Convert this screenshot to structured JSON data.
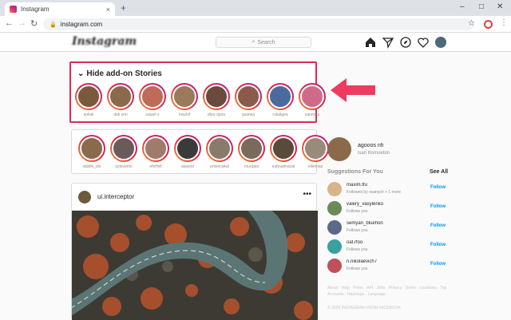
{
  "browser": {
    "tab_title": "Instagram",
    "tab_close": "×",
    "new_tab": "+",
    "window_minimize": "–",
    "window_maximize": "□",
    "window_close": "✕",
    "back": "←",
    "forward": "→",
    "reload": "↻",
    "url": "instagram.com",
    "lock": "🔒",
    "star": "☆",
    "menu": "⋮"
  },
  "header": {
    "logo": "Instagram",
    "search_placeholder": "Search",
    "icons": [
      "home-icon",
      "direct-icon",
      "explore-icon",
      "heart-icon",
      "profile-avatar"
    ]
  },
  "addon": {
    "toggle_icon": "chevron-down-icon",
    "label": "Hide add-on Stories",
    "stories": [
      {
        "username": "aoiiaii",
        "color": "#7a5a3a"
      },
      {
        "username": "dsb srin",
        "color": "#8a6a4a"
      },
      {
        "username": "saqeil s",
        "color": "#c06a5a"
      },
      {
        "username": "mackif",
        "color": "#9a7a5a"
      },
      {
        "username": "dlya cipsu",
        "color": "#6a4a3a"
      },
      {
        "username": "gsarwa",
        "color": "#8a5a4a"
      },
      {
        "username": "rukalgea",
        "color": "#4a6aa0"
      },
      {
        "username": "sanmiks",
        "color": "#d06a8a"
      }
    ]
  },
  "stories": [
    {
      "username": "dublik_ols",
      "color": "#8a6a4a"
    },
    {
      "username": "aylovemo",
      "color": "#6a5a5a"
    },
    {
      "username": "eferfefl",
      "color": "#a07a6a"
    },
    {
      "username": "alaiurel",
      "color": "#3a3a3a"
    },
    {
      "username": "prtsincakal",
      "color": "#8a7a6a"
    },
    {
      "username": "murqaia",
      "color": "#7a6a5a"
    },
    {
      "username": "eafyaamaoal",
      "color": "#5a4a3a"
    },
    {
      "username": "ellimnas",
      "color": "#9a8a7a"
    }
  ],
  "post": {
    "username": "ui.interceptor",
    "more": "•••"
  },
  "sidebar": {
    "profile_name": "agooos nfi",
    "profile_sub": "lsan lfismoeton",
    "suggestions_title": "Suggestions For You",
    "see_all": "See All",
    "suggestions": [
      {
        "name": "maxim.tfu",
        "sub": "Followed by ovanych + 1 more",
        "follow": "Follow",
        "color": "#d8b48a"
      },
      {
        "name": "valery_vasylenko",
        "sub": "Follows you",
        "follow": "Follow",
        "color": "#6a8a5a"
      },
      {
        "name": "semyan_bluehon",
        "sub": "Follows you",
        "follow": "Follow",
        "color": "#5a6a8a"
      },
      {
        "name": "oat.rfoo",
        "sub": "Follows you",
        "follow": "Follow",
        "color": "#3aa0a0"
      },
      {
        "name": "n.nikolaevich7",
        "sub": "Follows you",
        "follow": "Follow",
        "color": "#c0505a"
      }
    ],
    "footer_links": "About · Help · Press · API · Jobs · Privacy · Terms · Locations · Top Accounts · Hashtags · Language",
    "copyright": "© 2020 INSTAGRAM FROM FACEBOOK"
  },
  "colors": {
    "highlight": "#e02955",
    "follow": "#0095f6"
  }
}
